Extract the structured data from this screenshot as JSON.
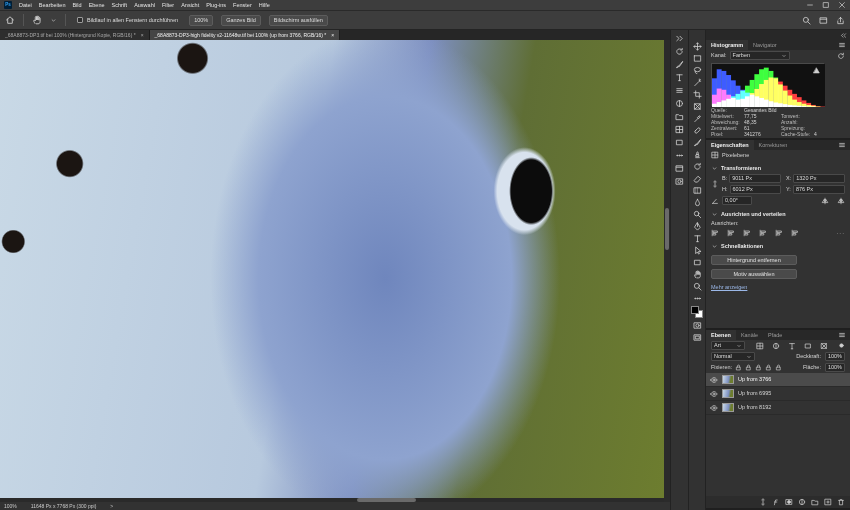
{
  "app": {
    "logo": "Ps"
  },
  "menu": [
    "Datei",
    "Bearbeiten",
    "Bild",
    "Ebene",
    "Schrift",
    "Auswahl",
    "Filter",
    "Ansicht",
    "Plug-ins",
    "Fenster",
    "Hilfe"
  ],
  "options_bar": {
    "scroll_all": {
      "label": "Bildlauf in allen Fenstern durchführen",
      "checked": false
    },
    "buttons": [
      "100%",
      "Ganzes Bild",
      "Bildschirm ausfüllen"
    ]
  },
  "document_tabs": [
    {
      "label": "_68A8873-DP3.tif bei 100% (Hintergrund Kopie, RGB/16) *",
      "close": "×",
      "selected": false
    },
    {
      "label": "_68A8873-DP3-high fidelity v2-11648w.tif bei 100% (up from 3766, RGB/16) *",
      "close": "×",
      "selected": true
    }
  ],
  "canvas": {
    "scroll": {
      "horizontal": 0.59,
      "vertical": 0.4
    }
  },
  "status_bar": {
    "zoom": "100%",
    "info": "11648 Px x 7768 Px (300 ppi)",
    "arrow": ">"
  },
  "histogram_panel": {
    "tabs": [
      {
        "label": "Histogramm",
        "selected": true
      },
      {
        "label": "Navigator",
        "selected": false
      }
    ],
    "channel_label": "Kanal:",
    "channel_value": "Farben",
    "chart": {
      "max": 100,
      "series": [
        {
          "name": "Rot",
          "color": "#ff3030",
          "values": [
            30,
            45,
            42,
            30,
            22,
            18,
            20,
            26,
            34,
            44,
            56,
            66,
            72,
            70,
            62,
            52,
            42,
            32,
            24,
            16,
            10,
            5,
            2,
            1
          ]
        },
        {
          "name": "Grün",
          "color": "#30ff30",
          "values": [
            8,
            12,
            16,
            20,
            26,
            32,
            40,
            52,
            66,
            80,
            92,
            96,
            88,
            72,
            55,
            40,
            28,
            18,
            12,
            8,
            5,
            3,
            1,
            0
          ]
        },
        {
          "name": "Blau",
          "color": "#3050ff",
          "values": [
            70,
            92,
            88,
            78,
            65,
            52,
            42,
            35,
            30,
            26,
            22,
            18,
            14,
            11,
            9,
            7,
            5,
            4,
            3,
            2,
            1,
            1,
            0,
            0
          ]
        }
      ]
    },
    "source": {
      "label": "Quelle:",
      "value": "Gesamtes Bild"
    },
    "stats_left": [
      {
        "label": "Mittelwert:",
        "value": "77,75"
      },
      {
        "label": "Abweichung:",
        "value": "48,35"
      },
      {
        "label": "Zentralwert:",
        "value": "61"
      },
      {
        "label": "Pixel:",
        "value": "341276"
      }
    ],
    "stats_right": [
      {
        "label": "Tonwert:"
      },
      {
        "label": "Anzahl:"
      },
      {
        "label": "Spreizung:"
      },
      {
        "label": "Cache-Stufe:",
        "value": "4"
      }
    ]
  },
  "properties_panel": {
    "tabs": [
      {
        "label": "Eigenschaften",
        "selected": true
      },
      {
        "label": "Korrekturen",
        "selected": false
      }
    ],
    "layer_kind": "Pixelebene",
    "transform": {
      "title": "Transformieren",
      "fields": [
        {
          "label": "B:",
          "value": "9011 Px"
        },
        {
          "label": "X:",
          "value": "1320 Px"
        },
        {
          "label": "H:",
          "value": "6012 Px"
        },
        {
          "label": "Y:",
          "value": "876 Px"
        }
      ],
      "angle": "0,00°"
    },
    "align": {
      "title": "Ausrichten und verteilen",
      "label": "Ausrichten:",
      "more": "···"
    },
    "quick_actions": {
      "title": "Schnellaktionen",
      "buttons": [
        "Hintergrund entfernen",
        "Motiv auswählen"
      ],
      "more": "Mehr anzeigen"
    }
  },
  "layers_panel": {
    "tabs": [
      {
        "label": "Ebenen",
        "selected": true
      },
      {
        "label": "Kanäle",
        "selected": false
      },
      {
        "label": "Pfade",
        "selected": false
      }
    ],
    "filter": "Art",
    "blend_mode": "Normal",
    "opacity_label": "Deckkraft:",
    "opacity": "100%",
    "lock_label": "Fixieren:",
    "fill_label": "Fläche:",
    "fill": "100%",
    "layers": [
      {
        "name": "Up from 3766",
        "visible": true,
        "selected": true
      },
      {
        "name": "Up from 6995",
        "visible": true,
        "selected": false
      },
      {
        "name": "Up from 8192",
        "visible": true,
        "selected": false
      }
    ]
  }
}
